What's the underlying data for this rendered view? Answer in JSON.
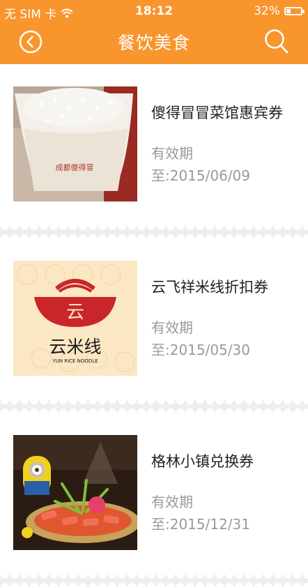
{
  "status_bar": {
    "carrier": "无 SIM 卡",
    "time": "18:12",
    "battery": "32%",
    "battery_level": 0.32
  },
  "nav": {
    "title": "餐饮美食",
    "back_icon": "back-circle-icon",
    "search_icon": "search-icon"
  },
  "colors": {
    "accent": "#f8952d",
    "separator": "#eeeeee",
    "secondary_text": "#9a9a9a"
  },
  "coupons": [
    {
      "name": "傻得冒冒菜馆惠宾券",
      "valid_label": "有效期",
      "valid_until": "至:2015/06/09",
      "image": "rice-bowl-image",
      "image_text": "成都傻得冒"
    },
    {
      "name": "云飞祥米线折扣券",
      "valid_label": "有效期",
      "valid_until": "至:2015/05/30",
      "image": "noodle-logo-image",
      "image_text": "云米线",
      "image_subtext": "YUN RICE NOODLE"
    },
    {
      "name": "格林小镇兑换券",
      "valid_label": "有效期",
      "valid_until": "至:2015/12/31",
      "image": "food-platter-image"
    }
  ]
}
